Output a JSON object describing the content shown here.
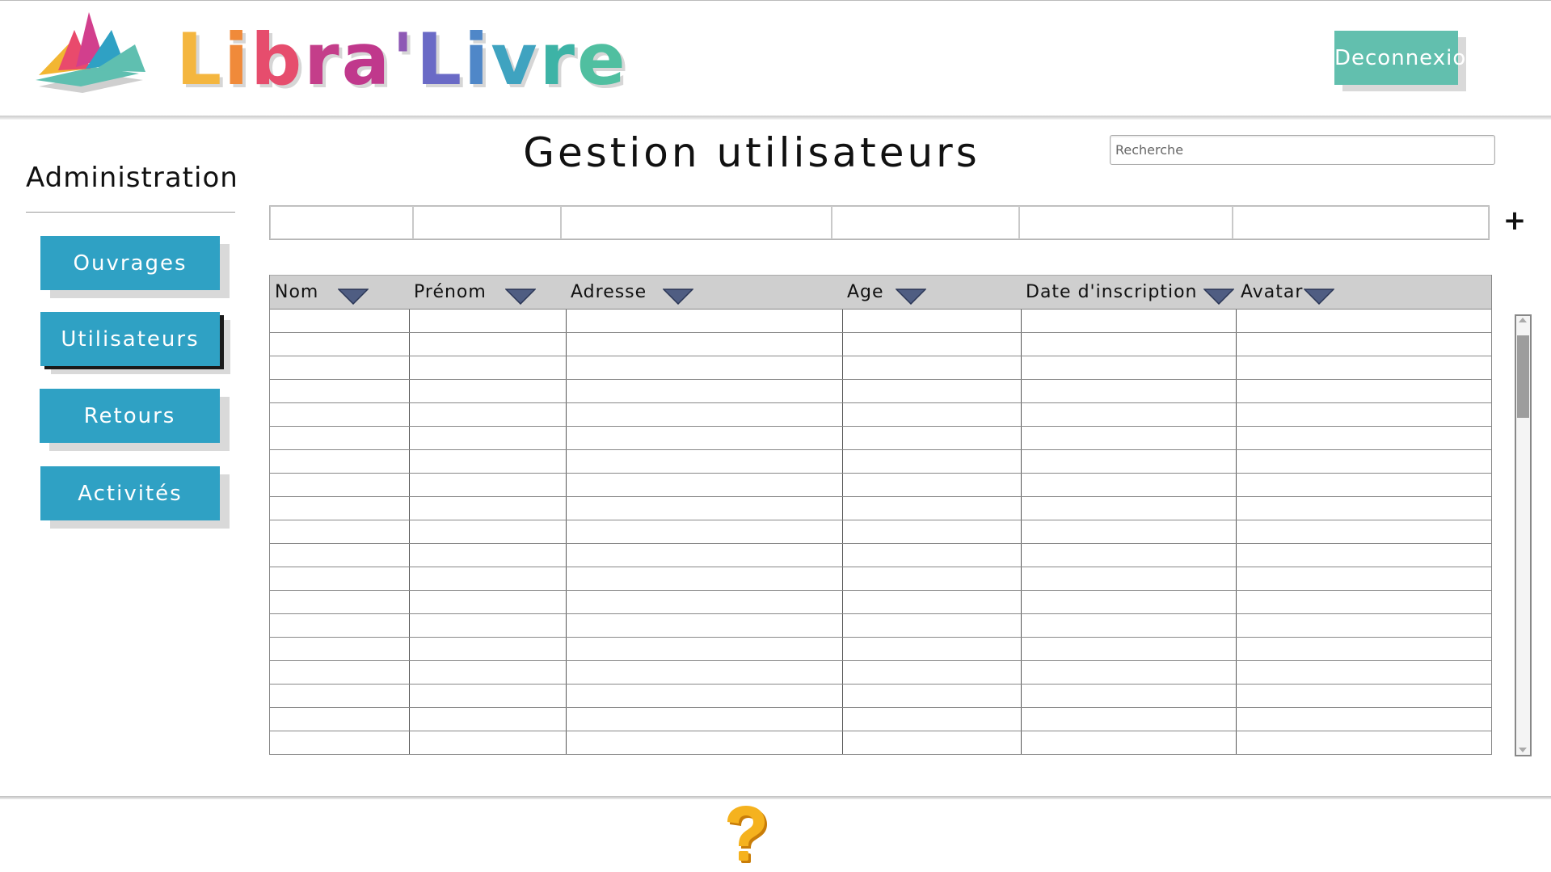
{
  "header": {
    "logo_text": "Libra'Livre",
    "logo_letters": [
      {
        "ch": "L",
        "color": "#f4b63f"
      },
      {
        "ch": "i",
        "color": "#f08a3a"
      },
      {
        "ch": "b",
        "color": "#e64d6d"
      },
      {
        "ch": "r",
        "color": "#c43e8a"
      },
      {
        "ch": "a",
        "color": "#c0388c"
      },
      {
        "ch": "'",
        "color": "#8e59b5"
      },
      {
        "ch": "L",
        "color": "#6a6ac6"
      },
      {
        "ch": "i",
        "color": "#4f87c8"
      },
      {
        "ch": "v",
        "color": "#3fa3c0"
      },
      {
        "ch": "r",
        "color": "#3db3a6"
      },
      {
        "ch": "e",
        "color": "#50bfa0"
      }
    ],
    "logout_label": "Deconnexion"
  },
  "sidebar": {
    "title": "Administration",
    "items": [
      {
        "label": "Ouvrages",
        "active": false
      },
      {
        "label": "Utilisateurs",
        "active": true
      },
      {
        "label": "Retours",
        "active": false
      },
      {
        "label": "Activités",
        "active": false
      }
    ]
  },
  "main": {
    "title": "Gestion utilisateurs",
    "search_placeholder": "Recherche",
    "add_label": "+",
    "columns": [
      "Nom",
      "Prénom",
      "Adresse",
      "Age",
      "Date d'inscription",
      "Avatar"
    ],
    "empty_rows": 19
  },
  "footer": {
    "help_icon": "question-mark-icon"
  },
  "colors": {
    "logout_button": "#62bfae",
    "nav_button": "#2fa1c4",
    "table_header": "#cfcfcf",
    "sort_icon": "#4a5a86",
    "help_icon": "#f2a81a"
  }
}
